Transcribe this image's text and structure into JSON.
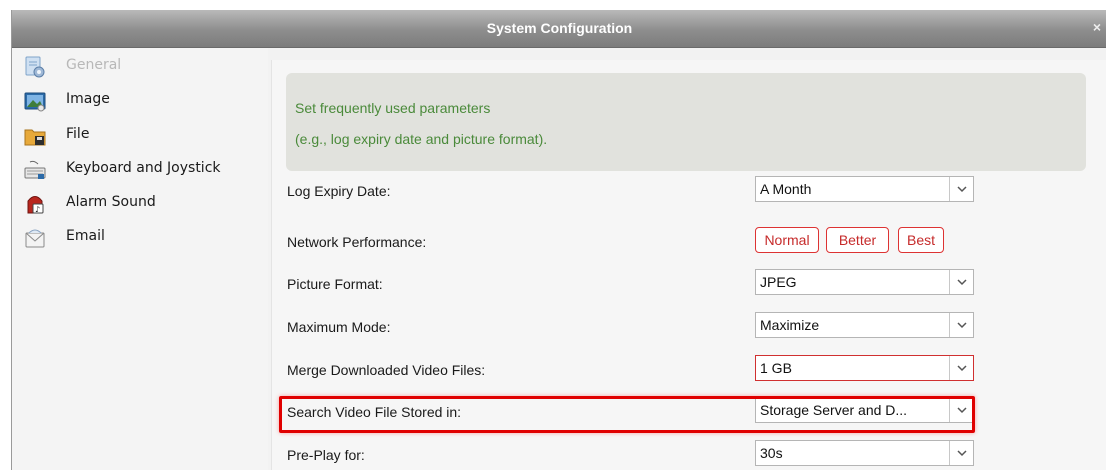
{
  "window": {
    "title": "System Configuration",
    "close_label": "×"
  },
  "sidebar": {
    "items": [
      {
        "label": "General",
        "icon": "general-settings-icon",
        "state": "disabled"
      },
      {
        "label": "Image",
        "icon": "image-icon"
      },
      {
        "label": "File",
        "icon": "folder-icon"
      },
      {
        "label": "Keyboard and Joystick",
        "icon": "keyboard-icon"
      },
      {
        "label": "Alarm Sound",
        "icon": "alarm-sound-icon"
      },
      {
        "label": "Email",
        "icon": "email-icon"
      }
    ]
  },
  "info": {
    "line1": "Set frequently used parameters",
    "line2": "(e.g., log expiry date and picture format)."
  },
  "settings": {
    "log_expiry": {
      "label": "Log Expiry Date:",
      "value": "A Month"
    },
    "network_performance": {
      "label": "Network Performance:",
      "options": [
        "Normal",
        "Better",
        "Best"
      ]
    },
    "picture_format": {
      "label": "Picture Format:",
      "value": "JPEG"
    },
    "maximum_mode": {
      "label": "Maximum Mode:",
      "value": "Maximize"
    },
    "merge_downloaded": {
      "label": "Merge Downloaded Video Files:",
      "value": "1 GB"
    },
    "search_video_stored": {
      "label": "Search Video File Stored in:",
      "value": "Storage Server and D..."
    },
    "pre_play": {
      "label": "Pre-Play for:",
      "value": "30s"
    }
  },
  "colors": {
    "accent_red": "#e00000",
    "info_text": "#4a8a3a",
    "info_bg": "#e1e2dd"
  }
}
